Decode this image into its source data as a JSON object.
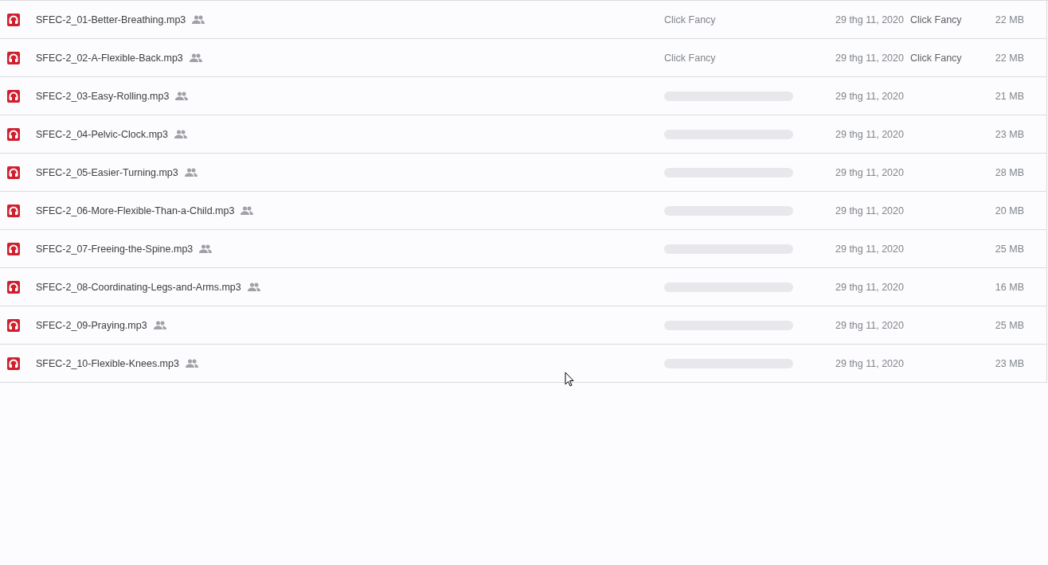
{
  "files": [
    {
      "name": "SFEC-2_01-Better-Breathing.mp3",
      "kind": "loaded",
      "owner": "Click Fancy",
      "modified": "29 thg 11, 2020",
      "modified_by": "Click Fancy",
      "size": "22 MB"
    },
    {
      "name": "SFEC-2_02-A-Flexible-Back.mp3",
      "kind": "loaded",
      "owner": "Click Fancy",
      "modified": "29 thg 11, 2020",
      "modified_by": "Click Fancy",
      "size": "22 MB"
    },
    {
      "name": "SFEC-2_03-Easy-Rolling.mp3",
      "kind": "loading",
      "modified": "29 thg 11, 2020",
      "size": "21 MB"
    },
    {
      "name": "SFEC-2_04-Pelvic-Clock.mp3",
      "kind": "loading",
      "modified": "29 thg 11, 2020",
      "size": "23 MB"
    },
    {
      "name": "SFEC-2_05-Easier-Turning.mp3",
      "kind": "loading",
      "modified": "29 thg 11, 2020",
      "size": "28 MB"
    },
    {
      "name": "SFEC-2_06-More-Flexible-Than-a-Child.mp3",
      "kind": "loading",
      "modified": "29 thg 11, 2020",
      "size": "20 MB"
    },
    {
      "name": "SFEC-2_07-Freeing-the-Spine.mp3",
      "kind": "loading",
      "modified": "29 thg 11, 2020",
      "size": "25 MB"
    },
    {
      "name": "SFEC-2_08-Coordinating-Legs-and-Arms.mp3",
      "kind": "loading",
      "modified": "29 thg 11, 2020",
      "size": "16 MB"
    },
    {
      "name": "SFEC-2_09-Praying.mp3",
      "kind": "loading",
      "modified": "29 thg 11, 2020",
      "size": "25 MB"
    },
    {
      "name": "SFEC-2_10-Flexible-Knees.mp3",
      "kind": "loading",
      "modified": "29 thg 11, 2020",
      "size": "23 MB"
    }
  ]
}
